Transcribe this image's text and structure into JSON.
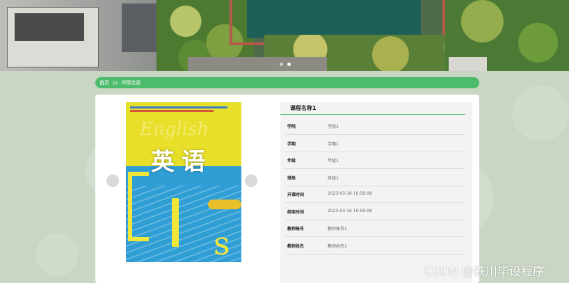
{
  "breadcrumb": {
    "home": "首页",
    "separator": "///",
    "current": "详情信息"
  },
  "course": {
    "name": "课程名称1",
    "fields": [
      {
        "label": "学院",
        "value": "学院1"
      },
      {
        "label": "学期",
        "value": "学期1"
      },
      {
        "label": "年级",
        "value": "年级1"
      },
      {
        "label": "班级",
        "value": "班级1"
      },
      {
        "label": "开课时间",
        "value": "2023-03-16 10:59:08"
      },
      {
        "label": "结束时间",
        "value": "2023-03-16 10:59:08"
      },
      {
        "label": "教师账号",
        "value": "教师账号1"
      },
      {
        "label": "教师姓名",
        "value": "教师姓名1"
      }
    ]
  },
  "book": {
    "title": "英语",
    "bg_text": "English"
  },
  "watermark": "CSDN @铁川毕设程序",
  "colors": {
    "accent": "#4dbb6c",
    "background": "#c9d6c4"
  },
  "carousel": {
    "dots": 2,
    "active": 1
  }
}
